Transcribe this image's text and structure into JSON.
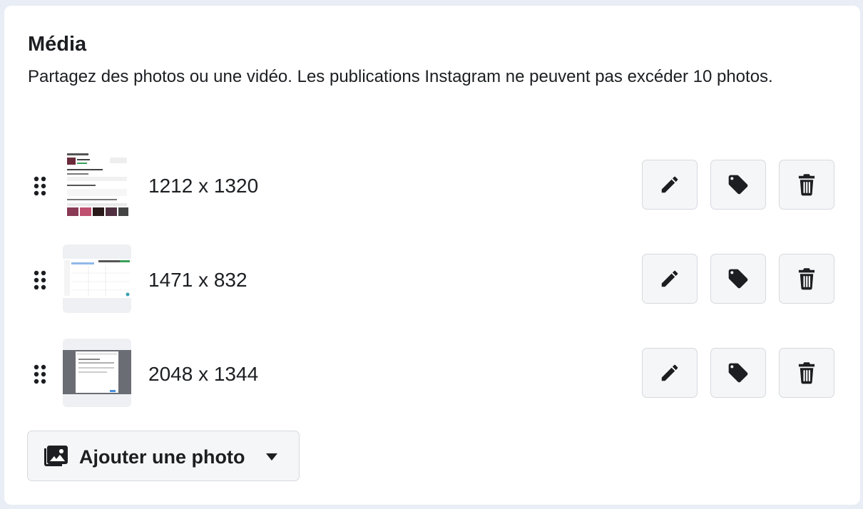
{
  "section": {
    "title": "Média",
    "description": "Partagez des photos ou une vidéo. Les publications Instagram ne peuvent pas excéder 10 photos."
  },
  "media_items": [
    {
      "dimensions": "1212 x 1320"
    },
    {
      "dimensions": "1471 x 832"
    },
    {
      "dimensions": "2048 x 1344"
    }
  ],
  "icons": {
    "drag": "drag-handle-icon",
    "edit": "pencil-icon",
    "tag": "tag-icon",
    "delete": "trash-icon",
    "add_photo": "photo-gallery-icon",
    "dropdown": "caret-down-icon"
  },
  "add_button": {
    "label": "Ajouter une photo"
  },
  "colors": {
    "background": "#e9edf5",
    "card": "#ffffff",
    "button_bg": "#f5f6f8",
    "button_border": "#d6d9de",
    "text": "#1c1e21"
  }
}
